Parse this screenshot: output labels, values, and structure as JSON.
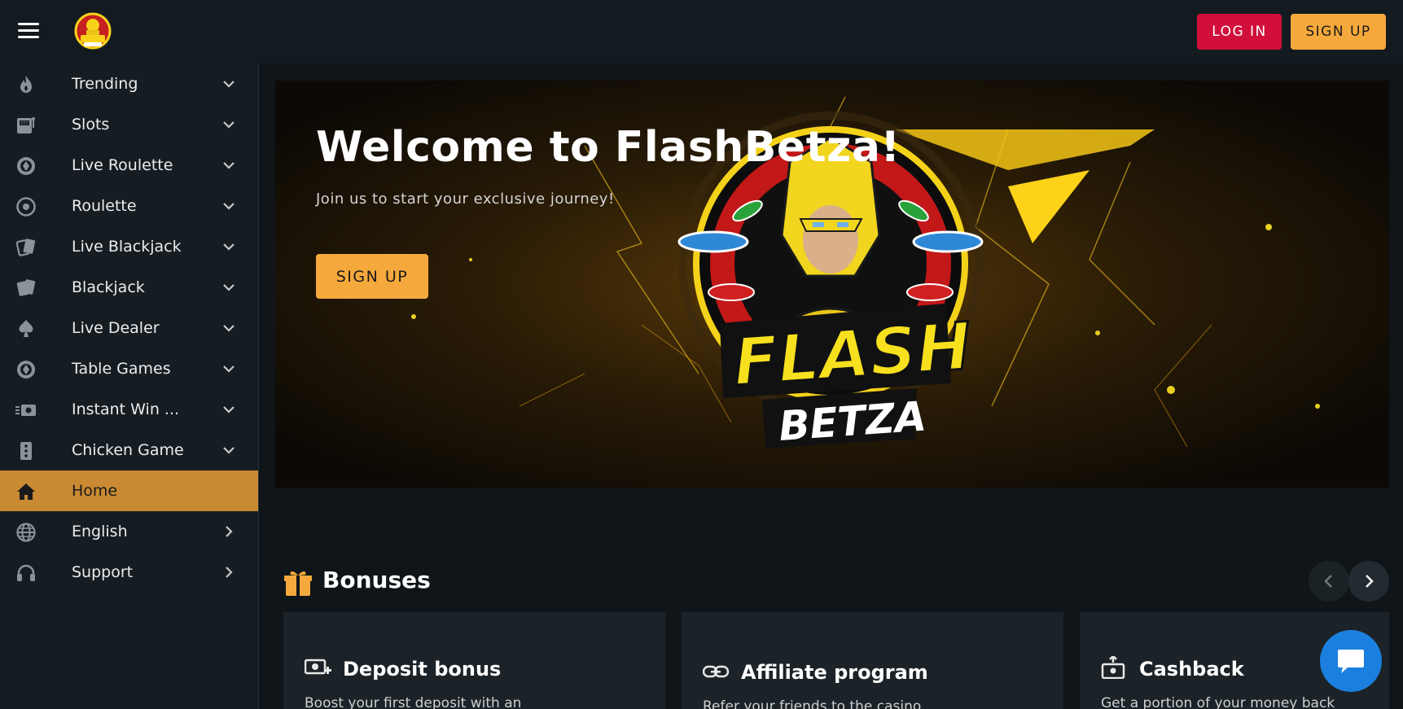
{
  "header": {
    "login_label": "LOG IN",
    "signup_label": "SIGN UP",
    "logo_text": "FLASH BETZA"
  },
  "sidebar": {
    "items": [
      {
        "label": "Trending",
        "icon": "fire-icon"
      },
      {
        "label": "Slots",
        "icon": "slot-machine-icon"
      },
      {
        "label": "Live Roulette",
        "icon": "roulette-chip-icon"
      },
      {
        "label": "Roulette",
        "icon": "roulette-wheel-icon"
      },
      {
        "label": "Live Blackjack",
        "icon": "cards-icon"
      },
      {
        "label": "Blackjack",
        "icon": "cards-icon"
      },
      {
        "label": "Live Dealer",
        "icon": "spade-icon"
      },
      {
        "label": "Table Games",
        "icon": "poker-chip-icon"
      },
      {
        "label": "Instant Win ...",
        "icon": "ticket-icon"
      },
      {
        "label": "Chicken Game",
        "icon": "dice-icon"
      },
      {
        "label": "Home",
        "icon": "home-icon",
        "active": true
      },
      {
        "label": "English",
        "icon": "globe-icon"
      },
      {
        "label": "Support",
        "icon": "headphones-icon"
      }
    ]
  },
  "hero": {
    "title": "Welcome to FlashBetza!",
    "subtitle": "Join us to start your exclusive journey!",
    "signup_label": "SIGN UP",
    "logo_text_1": "FLASH",
    "logo_text_2": "BETZA"
  },
  "bonuses": {
    "title": "Bonuses",
    "cards": [
      {
        "title": "Deposit bonus",
        "desc": "Boost your first deposit with an",
        "icon": "money-plus-icon"
      },
      {
        "title": "Affiliate program",
        "desc": "Refer your friends to the casino",
        "icon": "link-icon"
      },
      {
        "title": "Cashback",
        "desc": "Get a portion of your money back",
        "icon": "cashback-icon"
      }
    ]
  },
  "colors": {
    "accent": "#f5a93c",
    "login": "#d10f3a",
    "active_nav": "#c98a33",
    "chat": "#1b7fe0"
  }
}
